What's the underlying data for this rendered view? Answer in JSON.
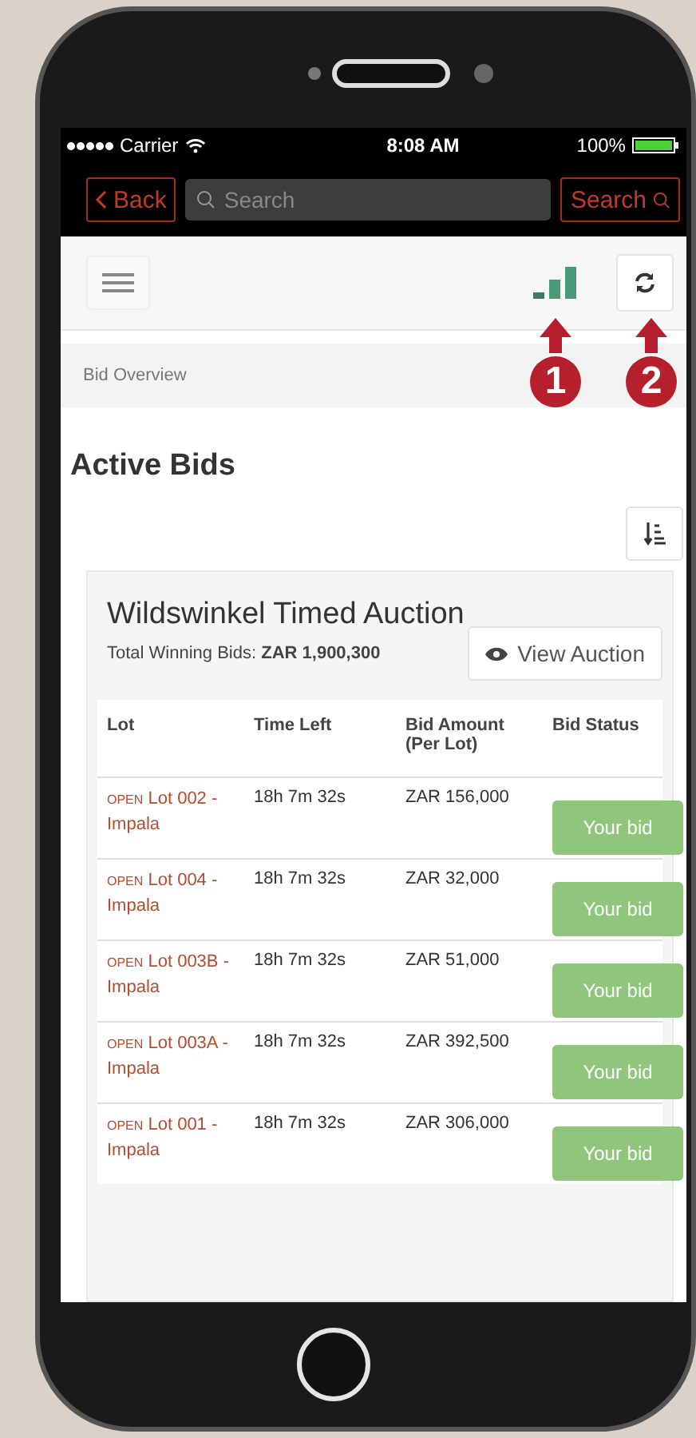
{
  "status_bar": {
    "carrier": "Carrier",
    "time": "8:08 AM",
    "battery": "100%"
  },
  "nav_bar": {
    "back": "Back",
    "search": {
      "placeholder": "Search"
    },
    "search_button": "Search"
  },
  "breadcrumb": "Bid Overview",
  "heading": "Active Bids",
  "auction": {
    "title": "Wildswinkel Timed Auction",
    "total": "Total Winning Bids: **ZAR 1,900,300**",
    "view_button": "View Auction",
    "columns": [
      "Lot",
      "Time Left",
      "Bid Amount (Per Lot)",
      "Bid Status"
    ],
    "rows": [
      {
        "state": "OPEN",
        "lot": "Lot 002 - Impala",
        "time_left": "18h 7m 32s",
        "amount": "ZAR 156,000",
        "status": "Your bid"
      },
      {
        "state": "OPEN",
        "lot": "Lot 004 - Impala",
        "time_left": "18h 7m 32s",
        "amount": "ZAR 32,000",
        "status": "Your bid"
      },
      {
        "state": "OPEN",
        "lot": "Lot 003B - Impala",
        "time_left": "18h 7m 32s",
        "amount": "ZAR 51,000",
        "status": "Your bid"
      },
      {
        "state": "OPEN",
        "lot": "Lot 003A - Impala",
        "time_left": "18h 7m 32s",
        "amount": "ZAR 392,500",
        "status": "Your bid"
      },
      {
        "state": "OPEN",
        "lot": "Lot 001 - Impala",
        "time_left": "18h 7m 32s",
        "amount": "ZAR 306,000",
        "status": "Your bid"
      }
    ]
  },
  "callouts": [
    "1",
    "2"
  ]
}
